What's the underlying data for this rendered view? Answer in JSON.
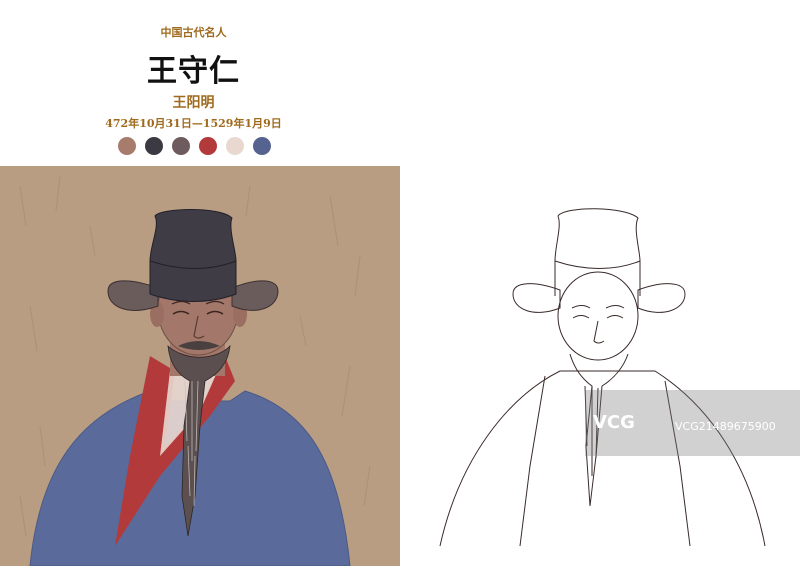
{
  "header": {
    "subtitle": "中国古代名人",
    "title": "王守仁",
    "alt_name": "王阳明",
    "dates": "472年10月31日—1529年1月9日"
  },
  "palette": [
    "#a87c6c",
    "#3b3a43",
    "#6e5b5e",
    "#b33a3a",
    "#e8d8d0",
    "#56628f"
  ],
  "colors": {
    "background": "#b99d83",
    "hat": "#3f3c45",
    "robe": "#5a6b9b",
    "collar": "#b33a3a",
    "skin": "#a3786a"
  },
  "watermark": {
    "brand": "VCG",
    "id": "VCG21489675900"
  }
}
